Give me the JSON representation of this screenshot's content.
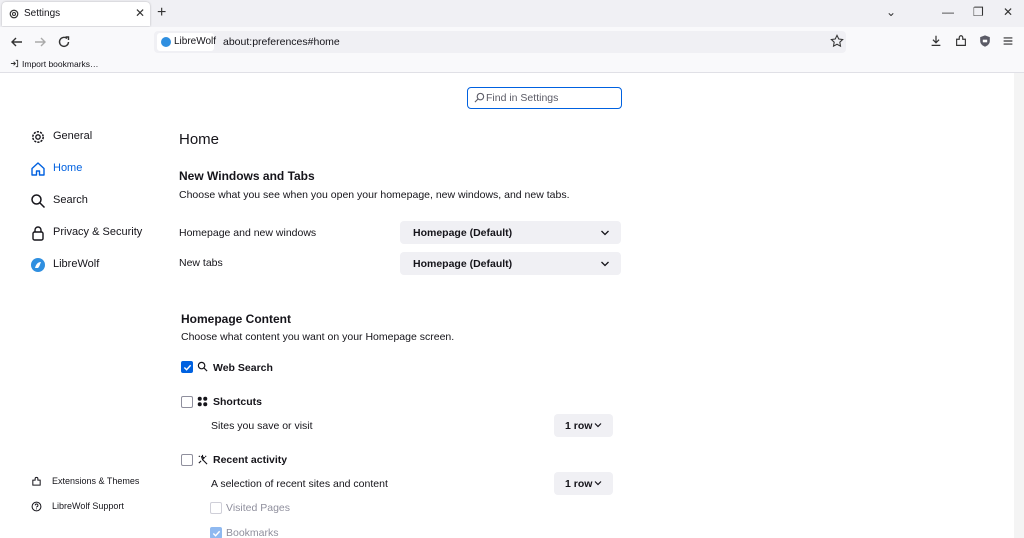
{
  "browser": {
    "tab_title": "Settings",
    "tab_close": "✕",
    "new_tab": "+",
    "identity_label": "LibreWolf",
    "url": "about:preferences#home",
    "bookmarks_import": "Import bookmarks…",
    "window_controls": {
      "list": "⌄",
      "minimize": "—",
      "restore": "❐",
      "close": "✕"
    }
  },
  "search": {
    "placeholder": "Find in Settings"
  },
  "sidebar": {
    "items": [
      {
        "label": "General",
        "icon": "gear-icon"
      },
      {
        "label": "Home",
        "icon": "home-icon",
        "active": true
      },
      {
        "label": "Search",
        "icon": "search-icon"
      },
      {
        "label": "Privacy & Security",
        "icon": "lock-icon"
      },
      {
        "label": "LibreWolf",
        "icon": "librewolf-icon"
      }
    ],
    "footer": [
      {
        "label": "Extensions & Themes",
        "icon": "puzzle-icon"
      },
      {
        "label": "LibreWolf Support",
        "icon": "help-icon"
      }
    ]
  },
  "main": {
    "title": "Home",
    "new_windows": {
      "heading": "New Windows and Tabs",
      "description": "Choose what you see when you open your homepage, new windows, and new tabs.",
      "homepage_label": "Homepage and new windows",
      "homepage_value": "Homepage (Default)",
      "newtabs_label": "New tabs",
      "newtabs_value": "Homepage (Default)"
    },
    "homepage_content": {
      "heading": "Homepage Content",
      "description": "Choose what content you want on your Homepage screen.",
      "web_search": {
        "label": "Web Search",
        "checked": true
      },
      "shortcuts": {
        "label": "Shortcuts",
        "checked": false,
        "sub": "Sites you save or visit",
        "rows": "1 row"
      },
      "recent": {
        "label": "Recent activity",
        "checked": false,
        "sub": "A selection of recent sites and content",
        "rows": "1 row",
        "visited": {
          "label": "Visited Pages",
          "checked": false
        },
        "bookmarks": {
          "label": "Bookmarks",
          "checked": true
        }
      }
    }
  },
  "colors": {
    "accent": "#0061e0",
    "chrome": "#f0f0f4"
  }
}
